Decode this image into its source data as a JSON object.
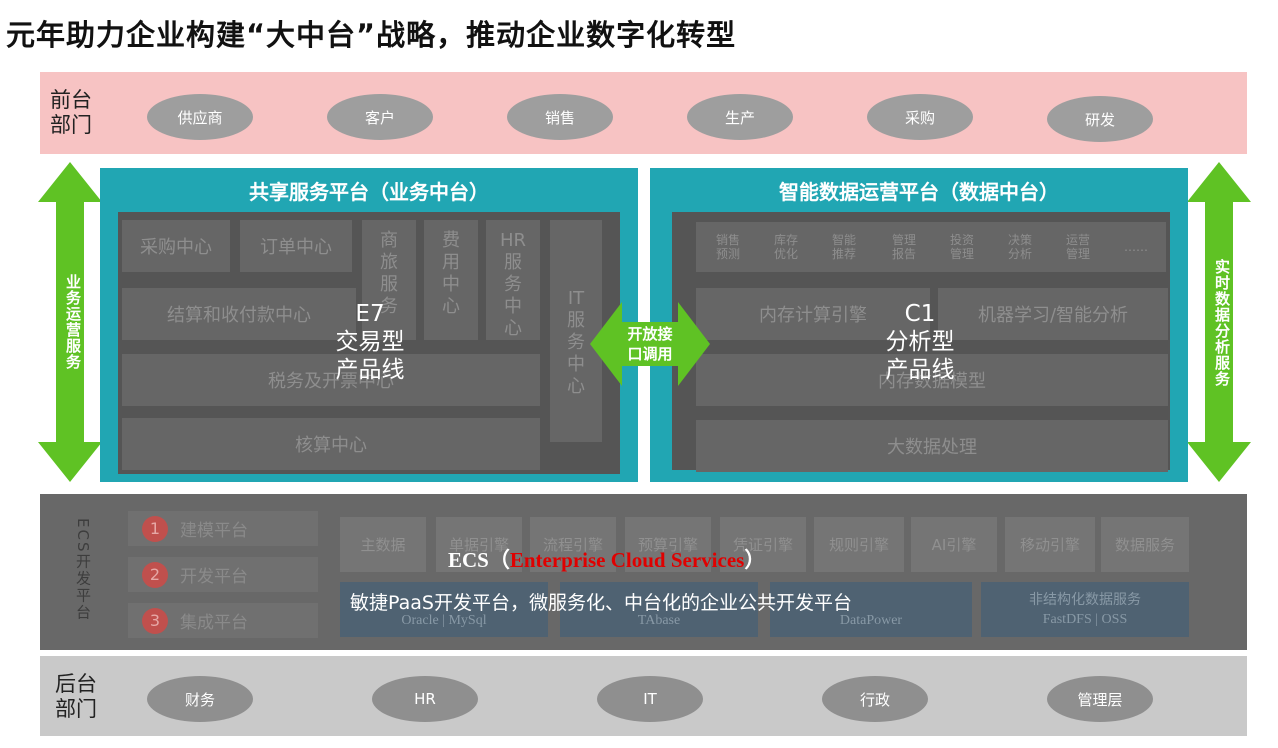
{
  "title": "元年助力企业构建“大中台”战略，推动企业数字化转型",
  "front": {
    "label": "前台\n部门",
    "items": [
      "供应商",
      "客户",
      "销售",
      "生产",
      "采购",
      "研发"
    ]
  },
  "back": {
    "label": "后台\n部门",
    "items": [
      "财务",
      "HR",
      "IT",
      "行政",
      "管理层"
    ]
  },
  "left_arrow_label": "业务运营服务",
  "right_arrow_label": "实时数据分析服务",
  "business_platform": {
    "title": "共享服务平台（业务中台）",
    "cells": {
      "purchase": "采购中心",
      "order": "订单中心",
      "commerce": "商\n旅\n服\n务",
      "expense": "费\n用\n中\n心",
      "hr": "HR\n服\n务\n中\n心",
      "it": "IT\n服\n务\n中\n心",
      "settlement": "结算和收付款中心",
      "tax": "税务及开票中心",
      "accounting": "核算中心"
    },
    "overlay": "E7\n交易型\n产品线"
  },
  "data_platform": {
    "title": "智能数据运营平台（数据中台）",
    "small_items": [
      "销售\n预测",
      "库存\n优化",
      "智能\n推荐",
      "管理\n报告",
      "投资\n管理",
      "决策\n分析",
      "运营\n管理",
      "……"
    ],
    "cells": {
      "memory": "内存计算引擎",
      "ml": "机器学习/智能分析",
      "model": "内存数据模型",
      "bigdata": "大数据处理"
    },
    "overlay": "C1\n分析型\n产品线"
  },
  "center_arrow_label": "开放接\n口调用",
  "ecs": {
    "side_label": "ECS开发平台",
    "platforms": [
      {
        "num": "1",
        "label": "建模平台"
      },
      {
        "num": "2",
        "label": "开发平台"
      },
      {
        "num": "3",
        "label": "集成平台"
      }
    ],
    "engines": [
      "主数据",
      "单据引擎",
      "流程引擎",
      "预算引擎",
      "凭证引擎",
      "规则引擎",
      "AI引擎",
      "移动引擎",
      "数据服务"
    ],
    "databases": [
      "Oracle | MySql",
      "TAbase",
      "DataPower"
    ],
    "unstructured": {
      "title": "非结构化数据服务",
      "sub": "FastDFS | OSS"
    },
    "headline_prefix": "ECS（",
    "headline_red": "Enterprise Cloud Services",
    "headline_suffix": "）",
    "subheadline": "敏捷PaaS开发平台，微服务化、中台化的企业公共开发平台"
  },
  "colors": {
    "front_band": "#f7c3c3",
    "platform_teal": "#21a6b3",
    "arrow_green": "#5fc224",
    "ecs_red": "#e00000"
  }
}
